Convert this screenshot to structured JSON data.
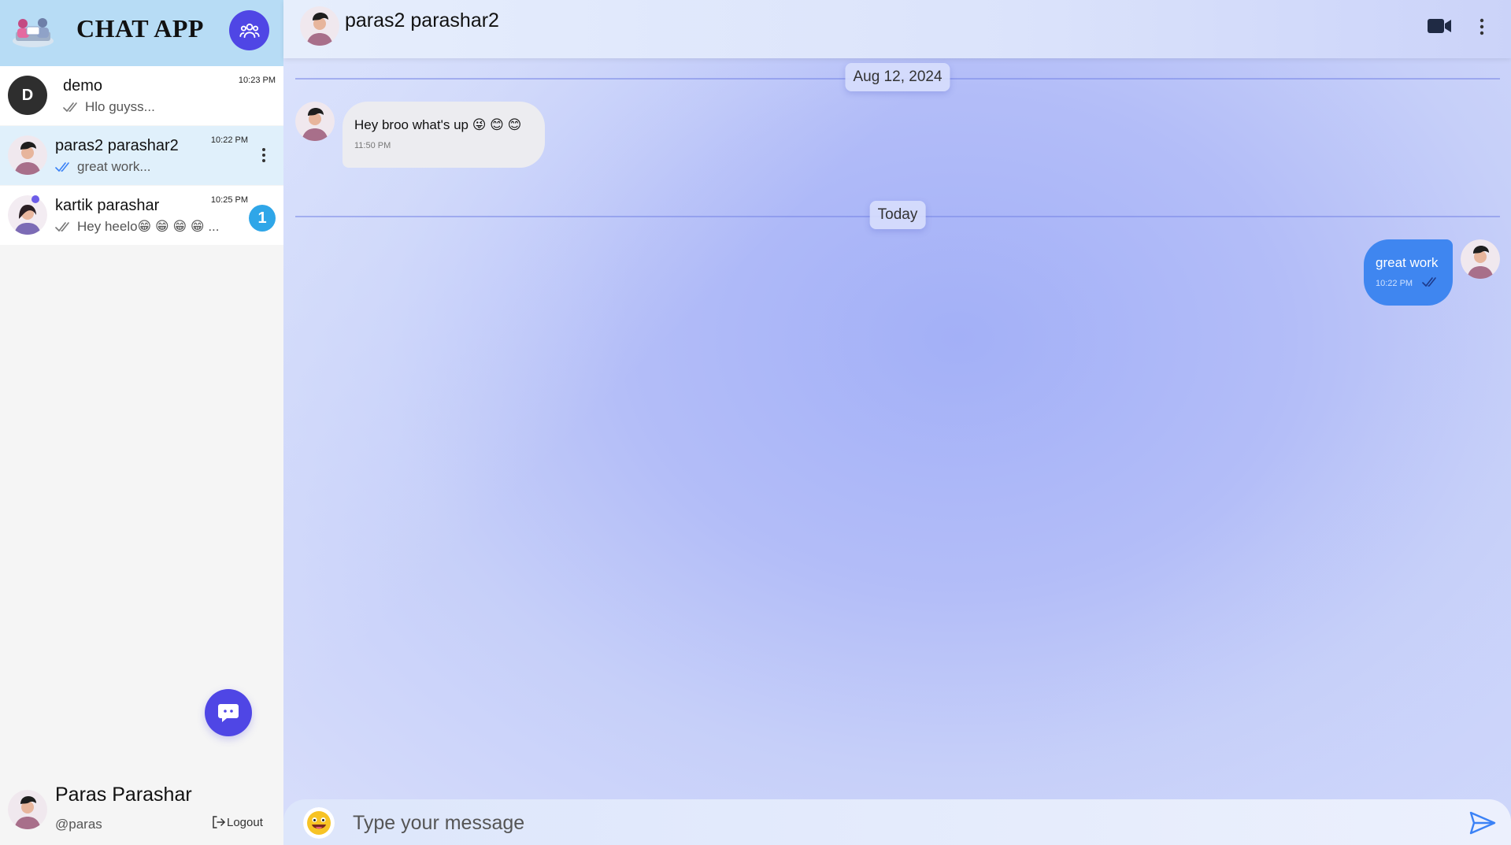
{
  "brand": {
    "title": "CHAT APP"
  },
  "conversations": [
    {
      "name": "demo",
      "initial": "D",
      "preview": "Hlo guyss...",
      "time": "10:23 PM",
      "read": false,
      "selected": false
    },
    {
      "name": "paras2 parashar2",
      "preview": "great work...",
      "time": "10:22 PM",
      "read": true,
      "selected": true
    },
    {
      "name": "kartik parashar",
      "preview": "Hey heelo😁 😁 😁 😁 ...",
      "time": "10:25 PM",
      "read": false,
      "selected": false,
      "unread": "1"
    }
  ],
  "profile": {
    "name": "Paras Parashar",
    "handle": "@paras",
    "logout": "Logout"
  },
  "chat": {
    "header": {
      "name": "paras2 parashar2"
    },
    "dates": [
      "Aug 12, 2024",
      "Today"
    ],
    "messages": [
      {
        "direction": "in",
        "text": "Hey broo what's up 😜 😊 😊",
        "time": "11:50 PM"
      },
      {
        "direction": "out",
        "text": "great work",
        "time": "10:22 PM"
      }
    ],
    "composer": {
      "placeholder": "Type your message"
    }
  },
  "colors": {
    "accent": "#4f46e5",
    "outgoing": "#3f86f0",
    "badge": "#2fa6e8",
    "brandBar": "#b7dcf5"
  },
  "icons": [
    "group-icon",
    "chat-icon",
    "logout-icon",
    "video-camera-icon",
    "kebab-menu-icon",
    "emoji-icon",
    "send-icon",
    "double-check-icon"
  ]
}
